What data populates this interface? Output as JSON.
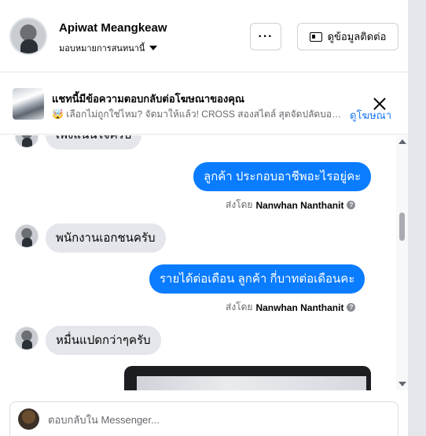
{
  "header": {
    "contact_name": "Apiwat Meangkeaw",
    "assignment_label": "มอบหมายการสนทนานี้",
    "more_label": "···",
    "contact_info_label": "ดูข้อมูลติดต่อ"
  },
  "ad_banner": {
    "title": "แชทนี้มีข้อความตอบกลับต่อโฆษณาของคุณ",
    "subtitle": "🤯 เลือกไม่ถูกใช่ไหม? จัดมาให้แล้ว! CROSS สองสไตล์ สุดจัดปลัดบอก! ...",
    "view_ad_label": "ดูโฆษณา"
  },
  "messages": [
    {
      "direction": "incoming",
      "text": "เพิ่งแน่นใจครับ"
    },
    {
      "direction": "outgoing",
      "text": "ลูกค้า  ประกอบอาชีพอะไรอยู่คะ",
      "sent_by_prefix": "ส่งโดย",
      "sent_by_name": "Nanwhan Nanthanit"
    },
    {
      "direction": "incoming",
      "text": "พนักงานเอกชนครับ"
    },
    {
      "direction": "outgoing",
      "text": "รายได้ต่อเดือน  ลูกค้า  กี่บาทต่อเดือนคะ",
      "sent_by_prefix": "ส่งโดย",
      "sent_by_name": "Nanwhan Nanthanit"
    },
    {
      "direction": "incoming",
      "text": "หมื่นแปดกว่าๆครับ"
    }
  ],
  "composer": {
    "placeholder": "ตอบกลับใน Messenger..."
  },
  "colors": {
    "outgoing_bubble": "#0a7cff",
    "incoming_bubble": "#e4e6eb",
    "link": "#1877f2"
  }
}
